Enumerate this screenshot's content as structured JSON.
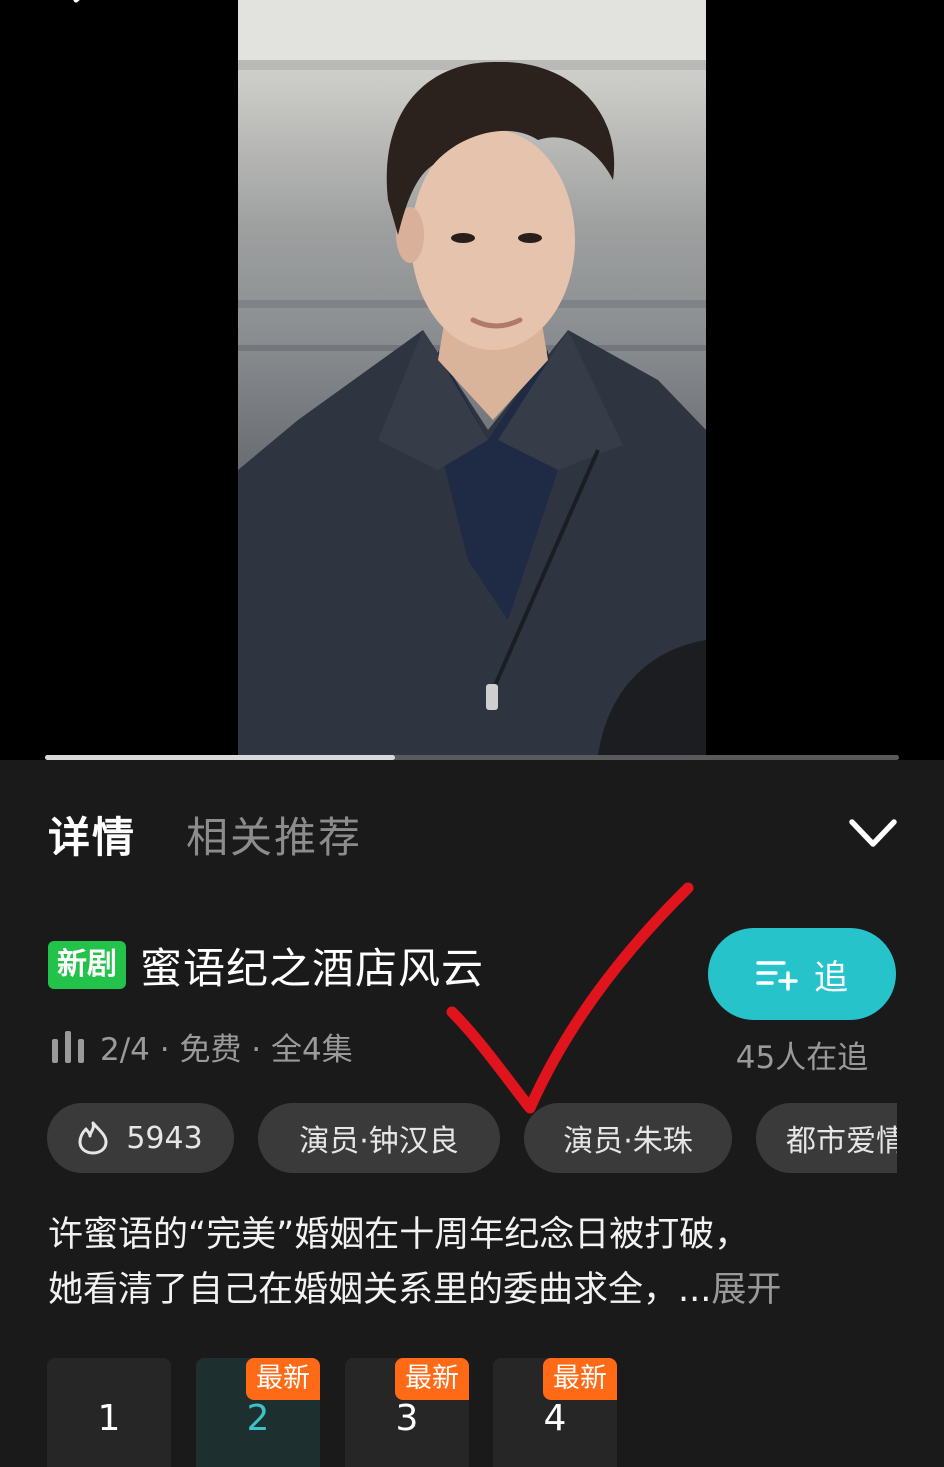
{
  "player": {
    "progress_fraction": 0.41
  },
  "detail": {
    "tabs": [
      {
        "label": "详情",
        "active": true
      },
      {
        "label": "相关推荐",
        "active": false
      }
    ],
    "new_badge": "新剧",
    "title": "蜜语纪之酒店风云",
    "meta": "2/4 · 免费 · 全4集",
    "follow": {
      "label": "追",
      "count_text": "45人在追",
      "color": "#27c3cb"
    },
    "chips": [
      {
        "label": "5943",
        "icon": "flame-icon"
      },
      {
        "label": "演员·钟汉良"
      },
      {
        "label": "演员·朱珠"
      },
      {
        "label": "都市爱情"
      }
    ],
    "description": {
      "line1": "许蜜语的“完美”婚姻在十周年纪念日被打破，",
      "line2": "她看清了自己在婚姻关系里的委曲求全，...",
      "expand": "展开"
    },
    "episodes": [
      {
        "number": "1",
        "badge": ""
      },
      {
        "number": "2",
        "badge": "最新"
      },
      {
        "number": "3",
        "badge": "最新"
      },
      {
        "number": "4",
        "badge": "最新"
      }
    ]
  },
  "colors": {
    "accent": "#27c3cb",
    "new_badge": "#22c24b",
    "latest_badge": "#ff6a17",
    "annotation": "#e0141c"
  }
}
